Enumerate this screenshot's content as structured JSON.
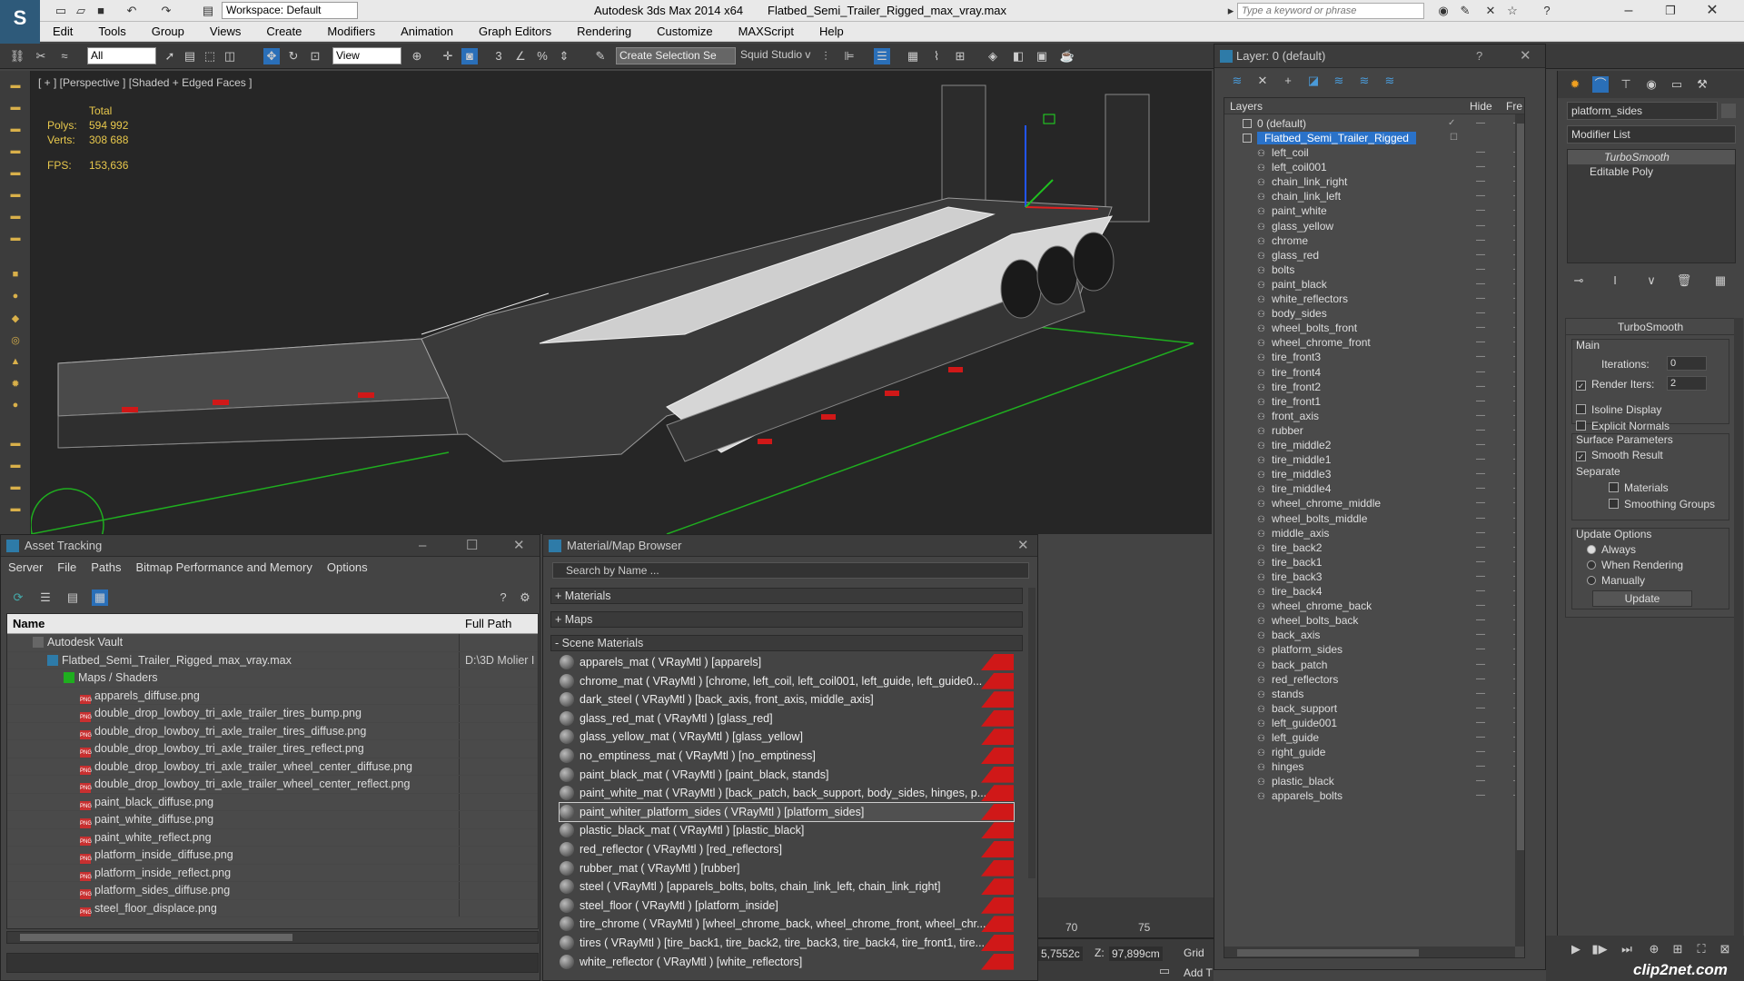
{
  "app": {
    "title": "Autodesk 3ds Max  2014 x64",
    "file": "Flatbed_Semi_Trailer_Rigged_max_vray.max",
    "workspace": "Workspace: Default",
    "search_placeholder": "Type a keyword or phrase"
  },
  "menu": [
    "Edit",
    "Tools",
    "Group",
    "Views",
    "Create",
    "Modifiers",
    "Animation",
    "Graph Editors",
    "Rendering",
    "Customize",
    "MAXScript",
    "Help"
  ],
  "toolbar": {
    "filter": "All",
    "ref_coord": "View",
    "selection_set": "Create Selection Se",
    "studio": "Squid Studio v"
  },
  "viewport": {
    "label": "[ + ] [Perspective ] [Shaded + Edged Faces ]",
    "stats_total": "Total",
    "polys_label": "Polys:",
    "polys": "594 992",
    "verts_label": "Verts:",
    "verts": "308 688",
    "fps_label": "FPS:",
    "fps": "153,636"
  },
  "asset_tracking": {
    "title": "Asset Tracking",
    "menu": [
      "Server",
      "File",
      "Paths",
      "Bitmap Performance and Memory",
      "Options"
    ],
    "col_name": "Name",
    "col_path": "Full Path",
    "vault": "Autodesk Vault",
    "file": "Flatbed_Semi_Trailer_Rigged_max_vray.max",
    "file_path": "D:\\3D Molier I",
    "maps": "Maps / Shaders",
    "items": [
      "apparels_diffuse.png",
      "double_drop_lowboy_tri_axle_trailer_tires_bump.png",
      "double_drop_lowboy_tri_axle_trailer_tires_diffuse.png",
      "double_drop_lowboy_tri_axle_trailer_tires_reflect.png",
      "double_drop_lowboy_tri_axle_trailer_wheel_center_diffuse.png",
      "double_drop_lowboy_tri_axle_trailer_wheel_center_reflect.png",
      "paint_black_diffuse.png",
      "paint_white_diffuse.png",
      "paint_white_reflect.png",
      "platform_inside_diffuse.png",
      "platform_inside_reflect.png",
      "platform_sides_diffuse.png",
      "steel_floor_displace.png"
    ]
  },
  "material_browser": {
    "title": "Material/Map Browser",
    "search": "Search by Name ...",
    "sec_materials": "+ Materials",
    "sec_maps": "+ Maps",
    "sec_scene": "- Scene Materials",
    "items": [
      "apparels_mat  ( VRayMtl ) [apparels]",
      "chrome_mat  ( VRayMtl ) [chrome, left_coil, left_coil001, left_guide, left_guide0...",
      "dark_steel  ( VRayMtl ) [back_axis, front_axis, middle_axis]",
      "glass_red_mat  ( VRayMtl ) [glass_red]",
      "glass_yellow_mat  ( VRayMtl ) [glass_yellow]",
      "no_emptiness_mat  ( VRayMtl ) [no_emptiness]",
      "paint_black_mat  ( VRayMtl ) [paint_black, stands]",
      "paint_white_mat  ( VRayMtl ) [back_patch, back_support, body_sides, hinges, p...",
      "paint_whiter_platform_sides ( VRayMtl ) [platform_sides]",
      "plastic_black_mat  ( VRayMtl ) [plastic_black]",
      "red_reflector  ( VRayMtl ) [red_reflectors]",
      "rubber_mat  ( VRayMtl ) [rubber]",
      "steel  ( VRayMtl ) [apparels_bolts, bolts, chain_link_left, chain_link_right]",
      "steel_floor  ( VRayMtl ) [platform_inside]",
      "tire_chrome  ( VRayMtl ) [wheel_chrome_back, wheel_chrome_front, wheel_chr...",
      "tires  ( VRayMtl ) [tire_back1, tire_back2, tire_back3, tire_back4, tire_front1, tire...",
      "white_reflector  ( VRayMtl ) [white_reflectors]"
    ]
  },
  "layer": {
    "title": "Layer: 0 (default)",
    "col_layers": "Layers",
    "col_hide": "Hide",
    "col_freeze": "Fre",
    "default": "0 (default)",
    "selected": "Flatbed_Semi_Trailer_Rigged",
    "objects": [
      "left_coil",
      "left_coil001",
      "chain_link_right",
      "chain_link_left",
      "paint_white",
      "glass_yellow",
      "chrome",
      "glass_red",
      "bolts",
      "paint_black",
      "white_reflectors",
      "body_sides",
      "wheel_bolts_front",
      "wheel_chrome_front",
      "tire_front3",
      "tire_front4",
      "tire_front2",
      "tire_front1",
      "front_axis",
      "rubber",
      "tire_middle2",
      "tire_middle1",
      "tire_middle3",
      "tire_middle4",
      "wheel_chrome_middle",
      "wheel_bolts_middle",
      "middle_axis",
      "tire_back2",
      "tire_back1",
      "tire_back3",
      "tire_back4",
      "wheel_chrome_back",
      "wheel_bolts_back",
      "back_axis",
      "platform_sides",
      "back_patch",
      "red_reflectors",
      "stands",
      "back_support",
      "left_guide001",
      "left_guide",
      "right_guide",
      "hinges",
      "plastic_black",
      "apparels_bolts"
    ]
  },
  "command_panel": {
    "object_name": "platform_sides",
    "modifier_list": "Modifier List",
    "stack": [
      "TurboSmooth",
      "Editable Poly"
    ],
    "rollout": "TurboSmooth",
    "main": "Main",
    "iterations_label": "Iterations:",
    "iterations": "0",
    "render_iters_label": "Render Iters:",
    "render_iters": "2",
    "isoline": "Isoline Display",
    "explicit": "Explicit Normals",
    "surface": "Surface Parameters",
    "smooth_result": "Smooth Result",
    "separate": "Separate",
    "materials": "Materials",
    "smoothing_groups": "Smoothing Groups",
    "update_options": "Update Options",
    "always": "Always",
    "when_rendering": "When Rendering",
    "manually": "Manually",
    "update": "Update"
  },
  "status": {
    "timeline_70": "70",
    "timeline_75": "75",
    "x_coord": "5,7552c",
    "z_label": "Z:",
    "z_coord": "97,899cm",
    "grid": "Grid",
    "add_t": "Add T"
  },
  "watermark": "clip2net.com"
}
